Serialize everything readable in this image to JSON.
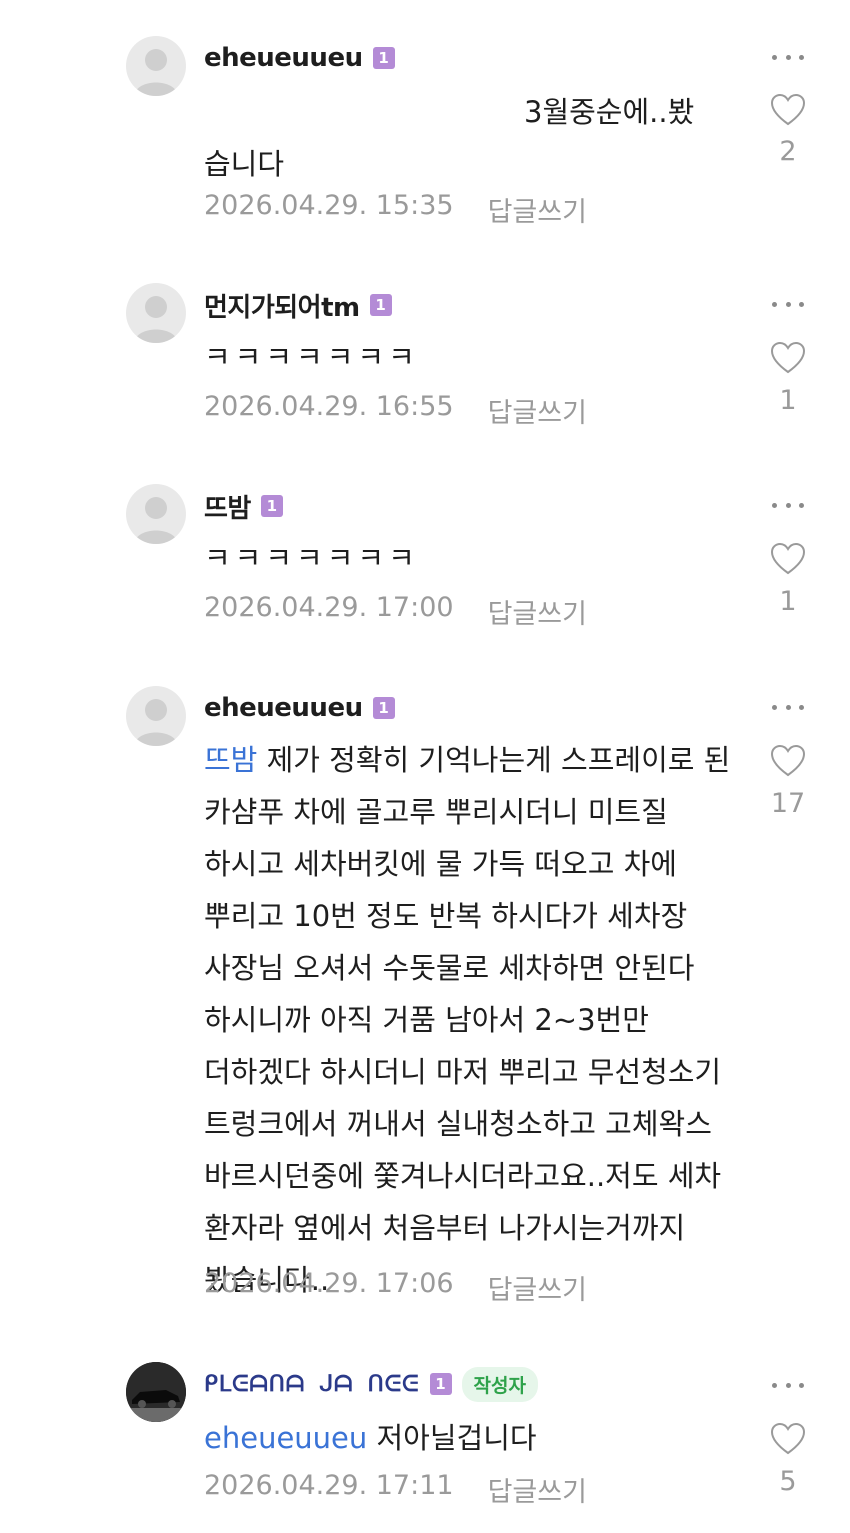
{
  "icons": {
    "avatar": "default-avatar-icon",
    "more": "more-dots-icon",
    "like": "heart-outline-icon"
  },
  "colors": {
    "mention": "#3a73d6",
    "level_badge": "#b48bd6",
    "author_badge_bg": "#e6f6ea",
    "author_badge_text": "#2ea24a",
    "meta": "#9a9a9a"
  },
  "comments": [
    {
      "nickname": "eheueuueu",
      "level": "1",
      "text_tail": "3월중순에..봤",
      "text_line2": "습니다",
      "date": "2026.04.29. 15:35",
      "reply": "답글쓰기",
      "likes": "2"
    },
    {
      "nickname": "먼지가되어tm",
      "level": "1",
      "text": "ㅋㅋㅋㅋㅋㅋㅋ",
      "date": "2026.04.29. 16:55",
      "reply": "답글쓰기",
      "likes": "1"
    },
    {
      "nickname": "뜨밤",
      "level": "1",
      "text": "ㅋㅋㅋㅋㅋㅋㅋ",
      "date": "2026.04.29. 17:00",
      "reply": "답글쓰기",
      "likes": "1"
    },
    {
      "nickname": "eheueuueu",
      "level": "1",
      "mention": "뜨밤",
      "text": "제가 정확히 기억나는게 스프레이로 된 카샴푸 차에 골고루 뿌리시더니 미트질 하시고 세차버킷에 물 가득 떠오고 차에 뿌리고 10번 정도 반복 하시다가 세차장 사장님 오셔서 수돗물로 세차하면 안된다 하시니까 아직 거품 남아서 2~3번만 더하겠다 하시더니 마저 뿌리고 무선청소기 트렁크에서 꺼내서 실내청소하고 고체왁스 바르시던중에 쫓겨나시더라고요..저도 세차 환자라 옆에서 처음부터 나가시는거까지 봤습니다..",
      "date": "2026.04.29. 17:06",
      "reply": "답글쓰기",
      "likes": "17"
    },
    {
      "nickname": "ᑭᒪᕮᗩᑎᗩ ᒍᗩ ᑎᕮᕮ",
      "level": "1",
      "author_badge": "작성자",
      "mention": "eheueuueu",
      "text": "저아닐겁니다",
      "date": "2026.04.29. 17:11",
      "reply": "답글쓰기",
      "likes": "5"
    }
  ]
}
